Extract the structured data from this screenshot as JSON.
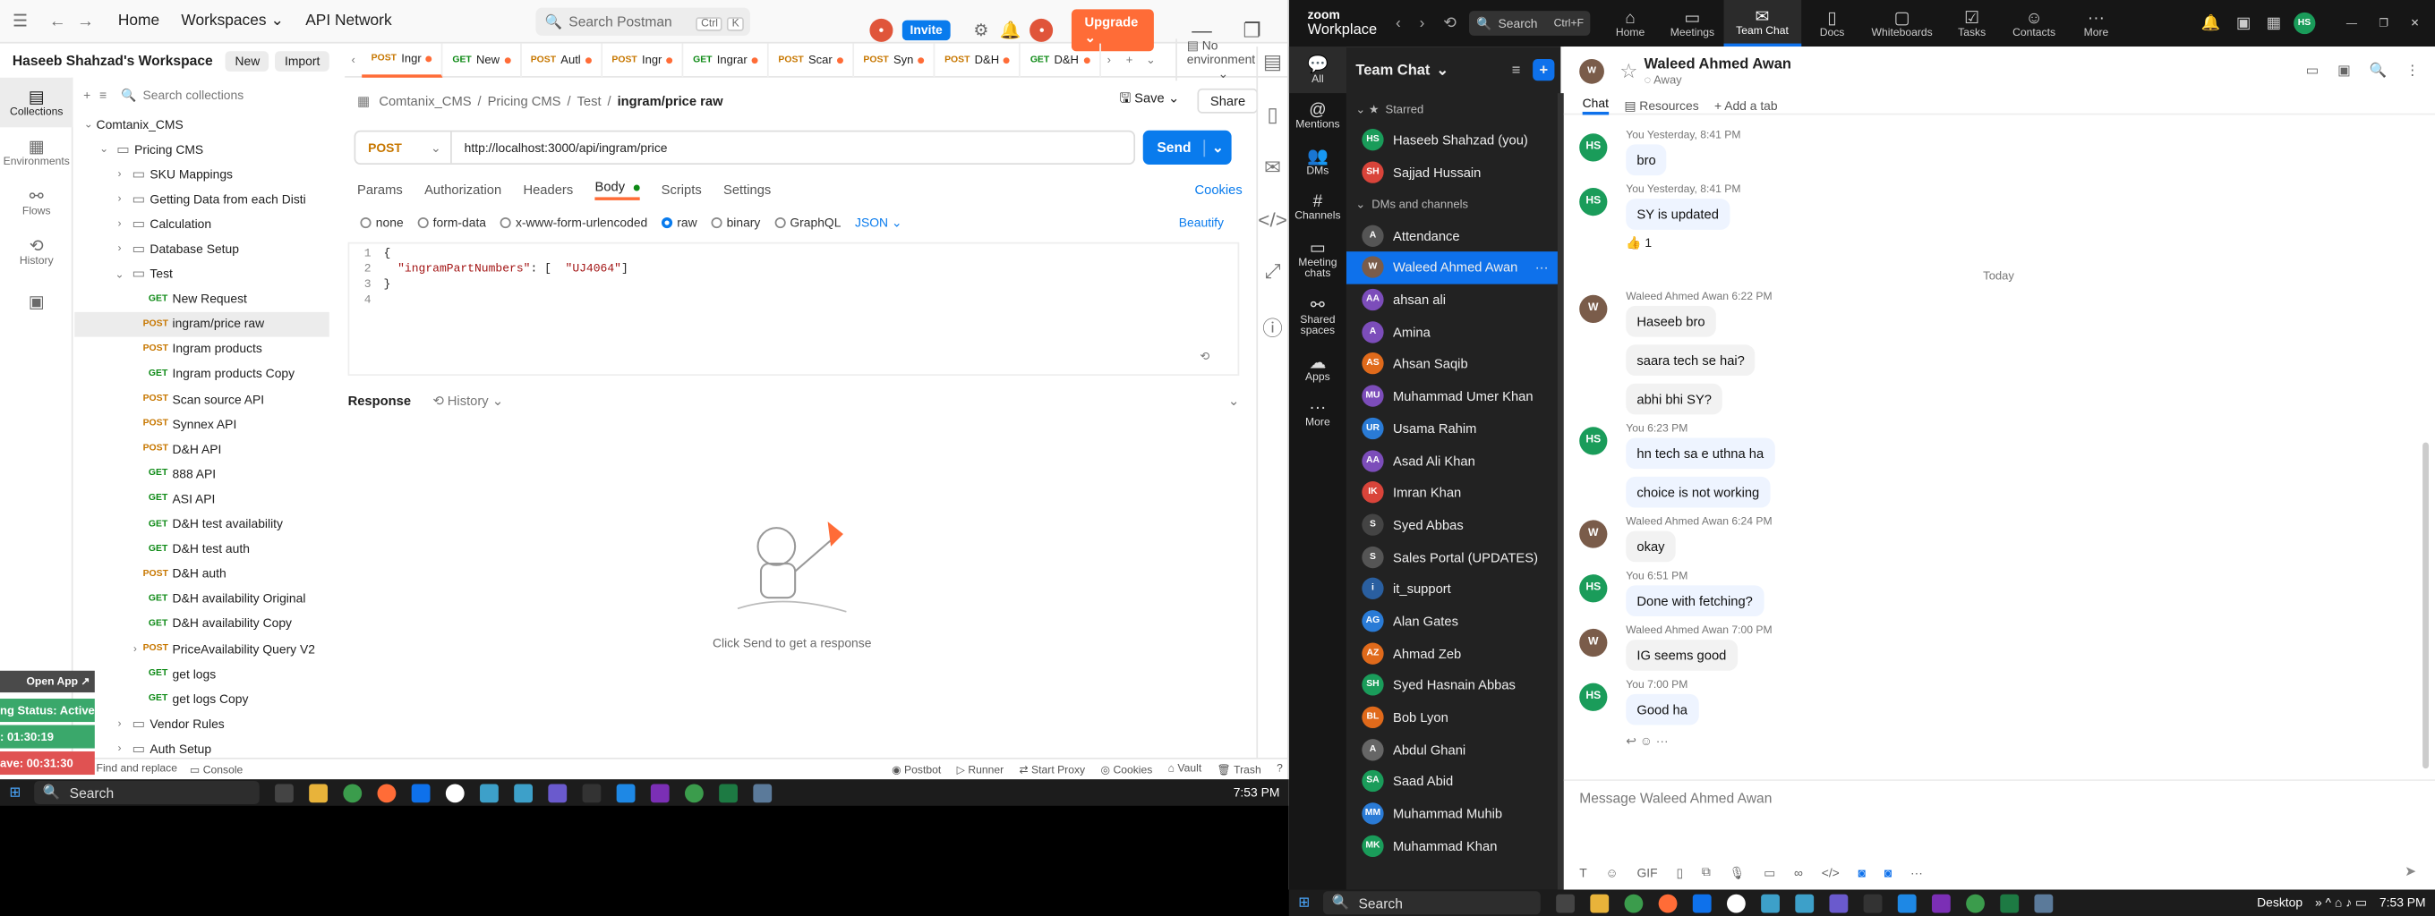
{
  "postman": {
    "nav": {
      "home": "Home",
      "workspaces": "Workspaces",
      "api_network": "API Network"
    },
    "search": {
      "placeholder": "Search Postman",
      "kbd1": "Ctrl",
      "kbd2": "K"
    },
    "invite": "Invite",
    "upgrade": "Upgrade",
    "workspace": {
      "name": "Haseeb Shahzad's Workspace",
      "new": "New",
      "import": "Import"
    },
    "rail": [
      {
        "label": "Collections",
        "icon": "folder-icon"
      },
      {
        "label": "Environments",
        "icon": "env-icon"
      },
      {
        "label": "Flows",
        "icon": "flows-icon"
      },
      {
        "label": "History",
        "icon": "history-icon"
      },
      {
        "label": "",
        "icon": "grid-icon"
      }
    ],
    "tree_search_placeholder": "Search collections",
    "tree": [
      {
        "level": 0,
        "type": "chev-open",
        "label": "Comtanix_CMS"
      },
      {
        "level": 1,
        "type": "folder-open",
        "label": "Pricing CMS"
      },
      {
        "level": 2,
        "type": "folder",
        "label": "SKU Mappings"
      },
      {
        "level": 2,
        "type": "folder",
        "label": "Getting Data from each Disti"
      },
      {
        "level": 2,
        "type": "folder",
        "label": "Calculation"
      },
      {
        "level": 2,
        "type": "folder",
        "label": "Database Setup"
      },
      {
        "level": 2,
        "type": "folder-open",
        "label": "Test"
      },
      {
        "level": 3,
        "type": "req",
        "method": "GET",
        "label": "New Request"
      },
      {
        "level": 3,
        "type": "req",
        "method": "POST",
        "label": "ingram/price raw",
        "selected": true
      },
      {
        "level": 3,
        "type": "req",
        "method": "POST",
        "label": "Ingram products"
      },
      {
        "level": 3,
        "type": "req",
        "method": "GET",
        "label": "Ingram products Copy"
      },
      {
        "level": 3,
        "type": "req",
        "method": "POST",
        "label": "Scan source API"
      },
      {
        "level": 3,
        "type": "req",
        "method": "POST",
        "label": "Synnex API"
      },
      {
        "level": 3,
        "type": "req",
        "method": "POST",
        "label": "D&H API"
      },
      {
        "level": 3,
        "type": "req",
        "method": "GET",
        "label": "888 API"
      },
      {
        "level": 3,
        "type": "req",
        "method": "GET",
        "label": "ASI API"
      },
      {
        "level": 3,
        "type": "req",
        "method": "GET",
        "label": "D&H test availability"
      },
      {
        "level": 3,
        "type": "req",
        "method": "GET",
        "label": "D&H test auth"
      },
      {
        "level": 3,
        "type": "req",
        "method": "POST",
        "label": "D&H auth"
      },
      {
        "level": 3,
        "type": "req",
        "method": "GET",
        "label": "D&H availability Original"
      },
      {
        "level": 3,
        "type": "req",
        "method": "GET",
        "label": "D&H availability Copy"
      },
      {
        "level": 3,
        "type": "req",
        "method": "POST",
        "label": "PriceAvailability Query V2",
        "chev": true
      },
      {
        "level": 3,
        "type": "req",
        "method": "GET",
        "label": "get logs"
      },
      {
        "level": 3,
        "type": "req",
        "method": "GET",
        "label": "get logs Copy"
      },
      {
        "level": 2,
        "type": "folder",
        "label": "Vendor Rules"
      },
      {
        "level": 2,
        "type": "folder",
        "label": "Auth Setup"
      }
    ],
    "tabs": [
      {
        "m": "POST",
        "t": "Ingr",
        "on": true
      },
      {
        "m": "GET",
        "t": "New"
      },
      {
        "m": "POST",
        "t": "Autl"
      },
      {
        "m": "POST",
        "t": "Ingr"
      },
      {
        "m": "GET",
        "t": "Ingrar"
      },
      {
        "m": "POST",
        "t": "Scar"
      },
      {
        "m": "POST",
        "t": "Syn"
      },
      {
        "m": "POST",
        "t": "D&H"
      },
      {
        "m": "GET",
        "t": "D&H"
      }
    ],
    "environment": "No environment",
    "crumb": [
      "Comtanix_CMS",
      "Pricing CMS",
      "Test",
      "ingram/price raw"
    ],
    "save": "Save",
    "share": "Share",
    "method": "POST",
    "url": "http://localhost:3000/api/ingram/price",
    "send": "Send",
    "subtabs": [
      "Params",
      "Authorization",
      "Headers",
      "Body",
      "Scripts",
      "Settings"
    ],
    "cookies": "Cookies",
    "body_opts": [
      "none",
      "form-data",
      "x-www-form-urlencoded",
      "raw",
      "binary",
      "GraphQL"
    ],
    "json_label": "JSON",
    "beautify": "Beautify",
    "code": {
      "l1": "{",
      "l2k": "\"ingramPartNumbers\"",
      "l2v": "\"UJ4064\"",
      "l3": "}"
    },
    "response": "Response",
    "history": "History",
    "empty": "Click Send to get a response",
    "status": [
      "Find and replace",
      "Console",
      "Postbot",
      "Runner",
      "Start Proxy",
      "Cookies",
      "Vault",
      "Trash"
    ],
    "overlay": {
      "open_app": "Open App ↗",
      "status": "ng Status: Active",
      "t1": ": 01:30:19",
      "t2": "ave: 00:31:30"
    }
  },
  "taskbar1": {
    "search": "Search",
    "time": "7:53 PM"
  },
  "taskbar2": {
    "search": "Search",
    "desktop": "Desktop",
    "time": "7:53 PM"
  },
  "zoom": {
    "brand1": "zoom",
    "brand2": "Workplace",
    "search": "Search",
    "search_kbd": "Ctrl+F",
    "nav": [
      {
        "l": "Home",
        "i": "home-icon"
      },
      {
        "l": "Meetings",
        "i": "video-icon"
      },
      {
        "l": "Team Chat",
        "i": "chat-icon",
        "on": true
      },
      {
        "l": "Docs",
        "i": "doc-icon"
      },
      {
        "l": "Whiteboards",
        "i": "whiteboard-icon"
      },
      {
        "l": "Tasks",
        "i": "tasks-icon"
      },
      {
        "l": "Contacts",
        "i": "contacts-icon"
      },
      {
        "l": "More",
        "i": "more-icon"
      }
    ],
    "rail": [
      {
        "l": "All",
        "on": true
      },
      {
        "l": "Mentions"
      },
      {
        "l": "DMs"
      },
      {
        "l": "Channels"
      },
      {
        "l": "Meeting chats"
      },
      {
        "l": "Shared spaces"
      },
      {
        "l": "Apps"
      },
      {
        "l": "More"
      }
    ],
    "list_title": "Team Chat",
    "starred": "Starred",
    "dms": "DMs and channels",
    "starred_items": [
      {
        "n": "Haseeb Shahzad (you)",
        "i": "HS",
        "c": "#1a9c5a"
      },
      {
        "n": "Sajjad Hussain",
        "i": "SH",
        "c": "#d9443a"
      }
    ],
    "items": [
      {
        "n": "Attendance",
        "i": "A",
        "c": "#555"
      },
      {
        "n": "Waleed Ahmed Awan",
        "i": "W",
        "c": "#7a5c4a",
        "sel": true
      },
      {
        "n": "ahsan ali",
        "i": "AA",
        "c": "#7c4dba"
      },
      {
        "n": "Amina",
        "i": "A",
        "c": "#7c4dba"
      },
      {
        "n": "Ahsan Saqib",
        "i": "AS",
        "c": "#e06a1b"
      },
      {
        "n": "Muhammad Umer Khan",
        "i": "MU",
        "c": "#7c4dba"
      },
      {
        "n": "Usama Rahim",
        "i": "UR",
        "c": "#2a7bd6"
      },
      {
        "n": "Asad Ali Khan",
        "i": "AA",
        "c": "#7c4dba"
      },
      {
        "n": "Imran Khan",
        "i": "IK",
        "c": "#d9443a"
      },
      {
        "n": "Syed Abbas",
        "i": "S",
        "c": "#444"
      },
      {
        "n": "Sales Portal (UPDATES)",
        "i": "S",
        "c": "#555"
      },
      {
        "n": "it_support",
        "i": "i",
        "c": "#2a5fa0"
      },
      {
        "n": "Alan Gates",
        "i": "AG",
        "c": "#2a7bd6"
      },
      {
        "n": "Ahmad Zeb",
        "i": "AZ",
        "c": "#e06a1b"
      },
      {
        "n": "Syed Hasnain Abbas",
        "i": "SH",
        "c": "#1a9c5a"
      },
      {
        "n": "Bob Lyon",
        "i": "BL",
        "c": "#e06a1b"
      },
      {
        "n": "Abdul Ghani",
        "i": "A",
        "c": "#666"
      },
      {
        "n": "Saad Abid",
        "i": "SA",
        "c": "#1a9c5a"
      },
      {
        "n": "Muhammad Muhib",
        "i": "MM",
        "c": "#2a7bd6"
      },
      {
        "n": "Muhammad Khan",
        "i": "MK",
        "c": "#1a9c5a"
      }
    ],
    "chat": {
      "name": "Waleed Ahmed Awan",
      "presence": "Away",
      "tabs": [
        "Chat",
        "Resources",
        "Add a tab"
      ],
      "today": "Today",
      "compose_placeholder": "Message Waleed Ahmed Awan"
    },
    "messages": [
      {
        "who": "me",
        "meta": "You Yesterday, 8:41 PM",
        "text": "bro"
      },
      {
        "who": "me",
        "meta": "You Yesterday, 8:41 PM",
        "text": "SY is updated",
        "reaction": "👍 1"
      },
      {
        "who": "them",
        "meta": "Waleed Ahmed Awan 6:22 PM",
        "text": "Haseeb bro"
      },
      {
        "who": "them",
        "meta": "",
        "text": "saara tech se hai?"
      },
      {
        "who": "them",
        "meta": "",
        "text": "abhi bhi SY?"
      },
      {
        "who": "me",
        "meta": "You 6:23 PM",
        "text": "hn tech sa e uthna ha"
      },
      {
        "who": "me",
        "meta": "",
        "text": "choice is not working"
      },
      {
        "who": "them",
        "meta": "Waleed Ahmed Awan 6:24 PM",
        "text": "okay"
      },
      {
        "who": "me",
        "meta": "You 6:51 PM",
        "text": "Done with fetching?"
      },
      {
        "who": "them",
        "meta": "Waleed Ahmed Awan 7:00 PM",
        "text": "IG seems good"
      },
      {
        "who": "me",
        "meta": "You 7:00 PM",
        "text": "Good ha"
      }
    ]
  }
}
